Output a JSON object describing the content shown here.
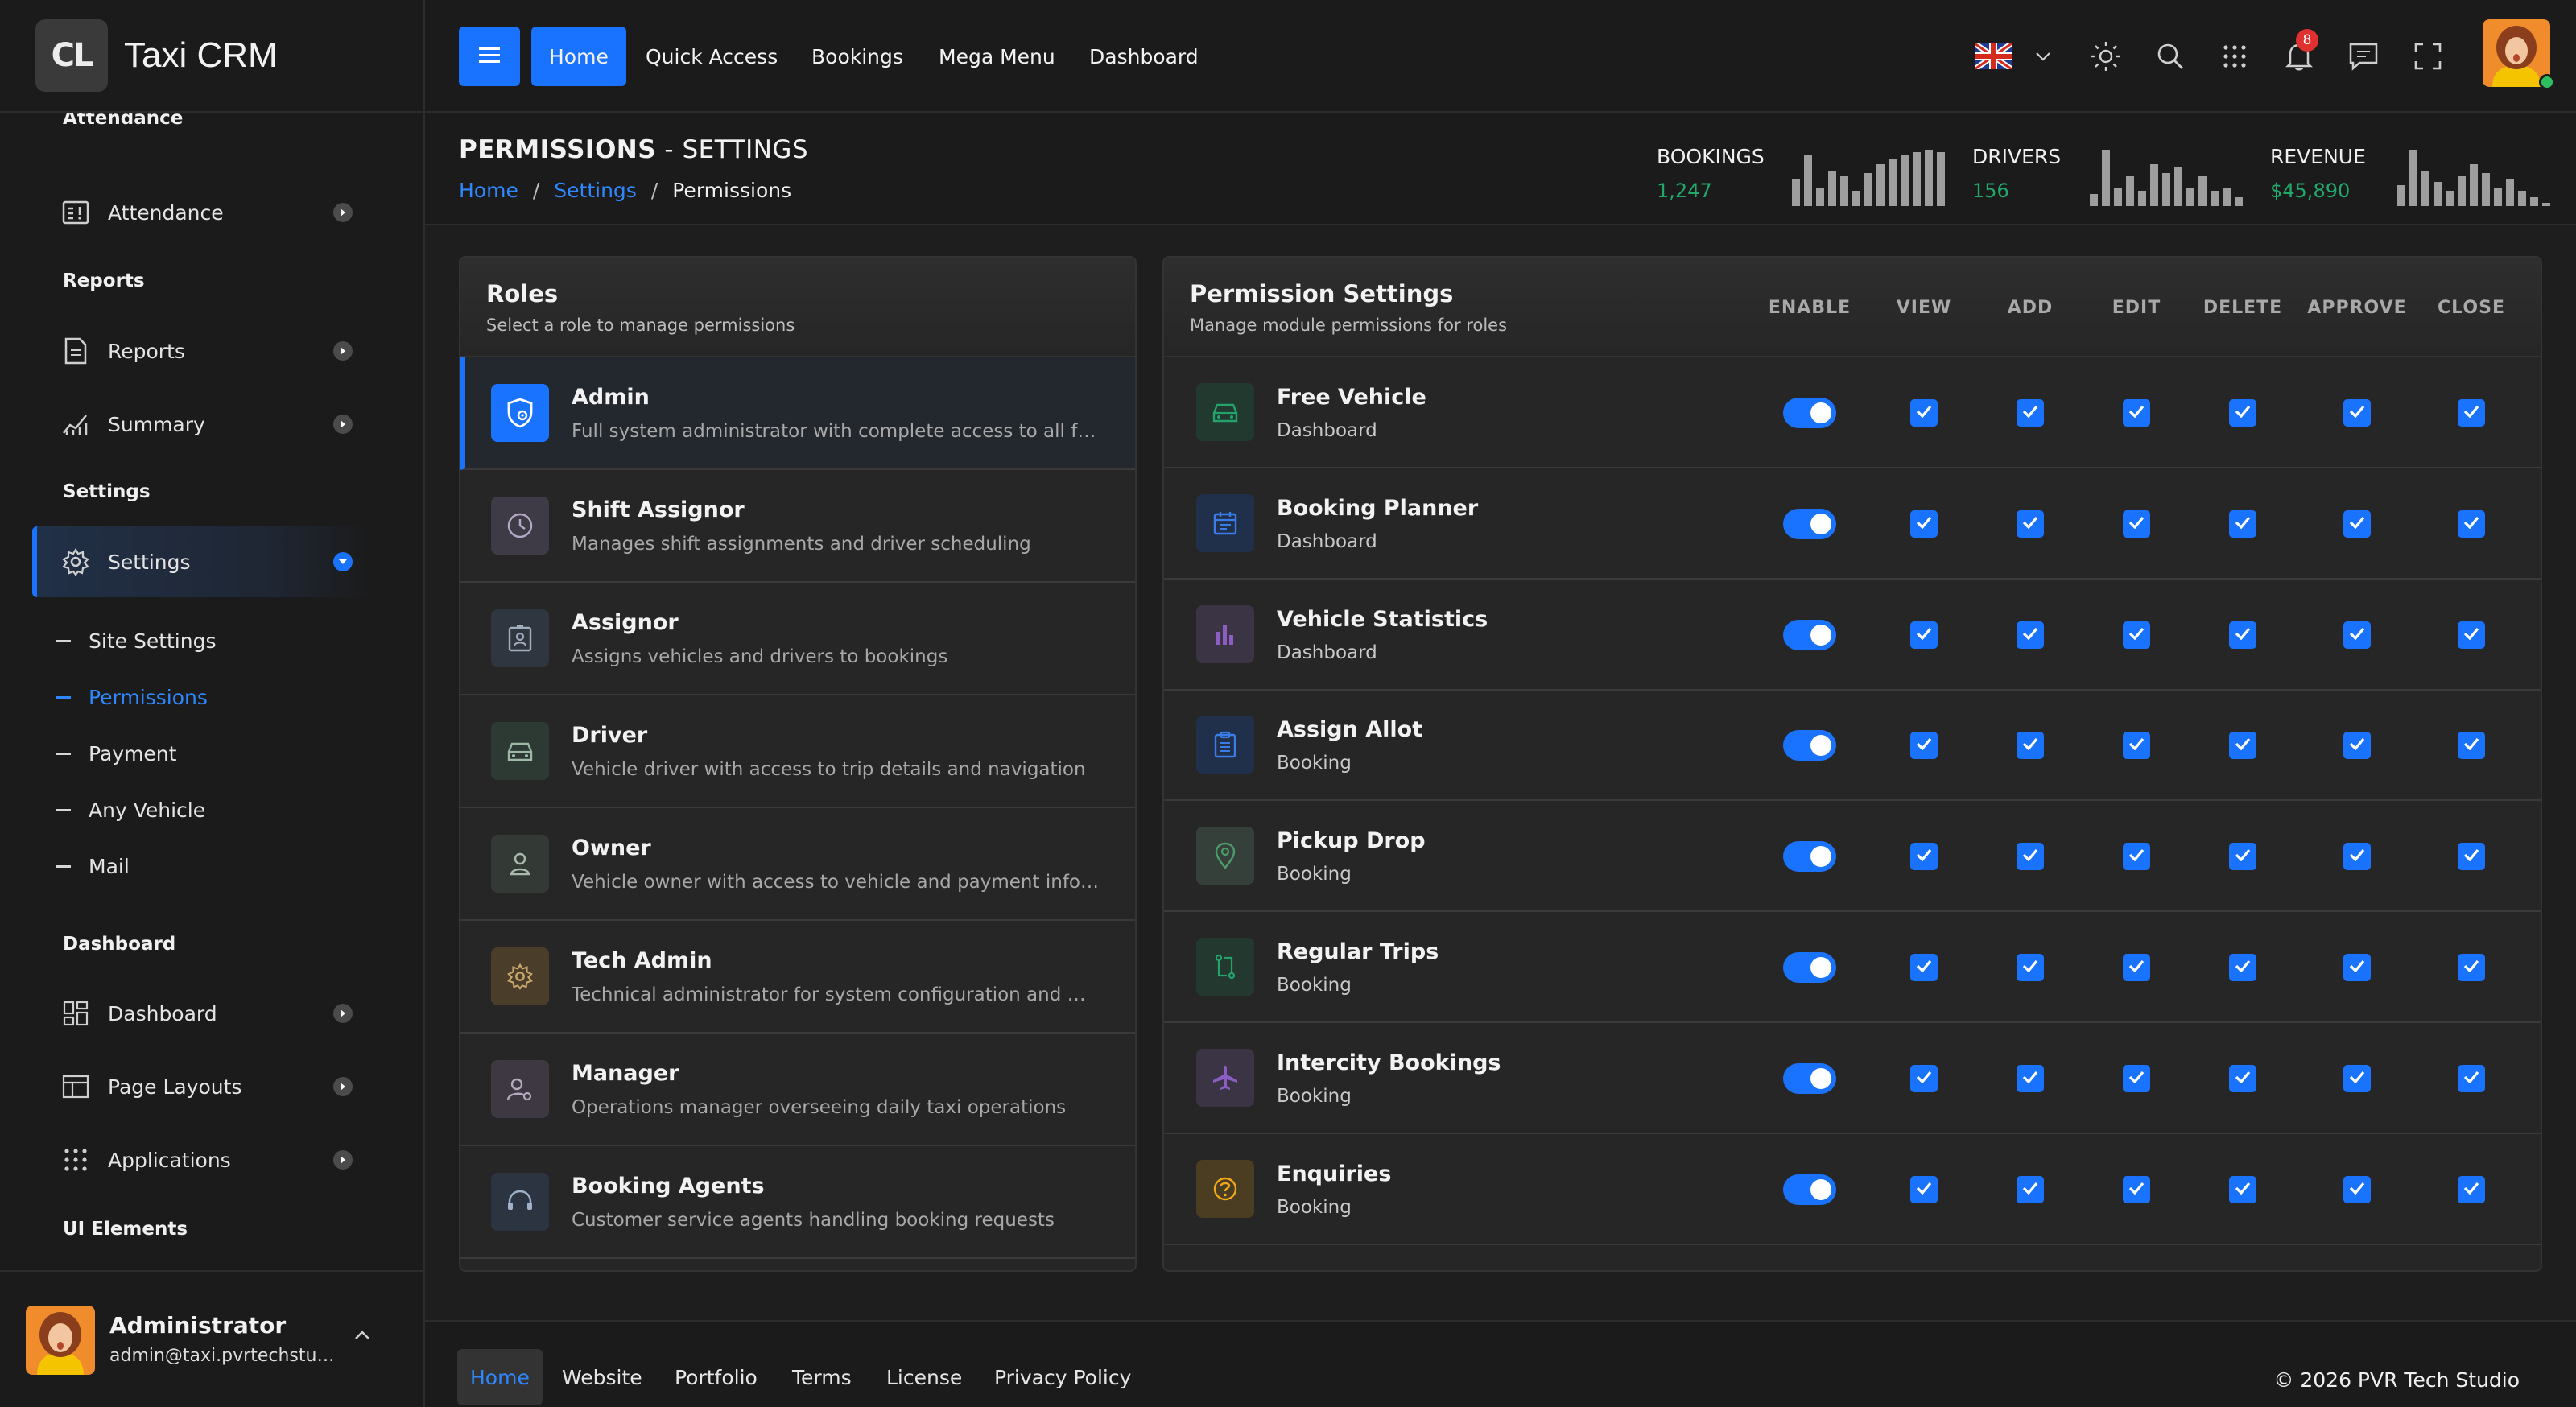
{
  "app": {
    "logo_text": "CL",
    "name": "Taxi CRM"
  },
  "sidebar": {
    "headings": {
      "attendance": "Attendance",
      "reports": "Reports",
      "settings": "Settings",
      "dashboard": "Dashboard",
      "ui_elements": "UI Elements"
    },
    "items": {
      "attendance": "Attendance",
      "reports": "Reports",
      "summary": "Summary",
      "settings": "Settings",
      "dashboard": "Dashboard",
      "page_layouts": "Page Layouts",
      "applications": "Applications"
    },
    "settings_sub": [
      "Site Settings",
      "Permissions",
      "Payment",
      "Any Vehicle",
      "Mail"
    ],
    "active_sub": "Permissions",
    "user": {
      "name": "Administrator",
      "email": "admin@taxi.pvrtechstudio.com"
    }
  },
  "header": {
    "nav": [
      "Home",
      "Quick Access",
      "Bookings",
      "Mega Menu",
      "Dashboard"
    ],
    "active_nav": "Home",
    "notification_count": "8",
    "icons": [
      "flag-uk-icon",
      "chevron-down-icon",
      "sun-icon",
      "search-icon",
      "apps-grid-icon",
      "bell-icon",
      "chat-icon",
      "fullscreen-icon"
    ]
  },
  "page": {
    "title_strong": "PERMISSIONS",
    "title_rest": " - SETTINGS",
    "breadcrumb": [
      "Home",
      "Settings",
      "Permissions"
    ],
    "stats": [
      {
        "label": "BOOKINGS",
        "value": "1,247",
        "bars": [
          0.45,
          0.85,
          0.3,
          0.6,
          0.5,
          0.25,
          0.55,
          0.7,
          0.8,
          0.85,
          0.9,
          0.95,
          0.9
        ]
      },
      {
        "label": "DRIVERS",
        "value": "156",
        "bars": [
          0.2,
          0.95,
          0.3,
          0.5,
          0.25,
          0.7,
          0.55,
          0.65,
          0.3,
          0.5,
          0.25,
          0.3,
          0.15
        ]
      },
      {
        "label": "REVENUE",
        "value": "$45,890",
        "bars": [
          0.35,
          0.95,
          0.6,
          0.4,
          0.25,
          0.5,
          0.7,
          0.55,
          0.3,
          0.45,
          0.25,
          0.15,
          0.05
        ]
      }
    ]
  },
  "roles": {
    "title": "Roles",
    "subtitle": "Select a role to manage permissions",
    "items": [
      {
        "name": "Admin",
        "desc": "Full system administrator with complete access to all features",
        "icon": "shield-user-icon"
      },
      {
        "name": "Shift Assignor",
        "desc": "Manages shift assignments and driver scheduling",
        "icon": "clock-icon"
      },
      {
        "name": "Assignor",
        "desc": "Assigns vehicles and drivers to bookings",
        "icon": "id-badge-icon"
      },
      {
        "name": "Driver",
        "desc": "Vehicle driver with access to trip details and navigation",
        "icon": "car-icon"
      },
      {
        "name": "Owner",
        "desc": "Vehicle owner with access to vehicle and payment information",
        "icon": "user-icon"
      },
      {
        "name": "Tech Admin",
        "desc": "Technical administrator for system configuration and maintenance",
        "icon": "gear-icon"
      },
      {
        "name": "Manager",
        "desc": "Operations manager overseeing daily taxi operations",
        "icon": "user-settings-icon"
      },
      {
        "name": "Booking Agents",
        "desc": "Customer service agents handling booking requests",
        "icon": "headset-icon"
      }
    ]
  },
  "permissions": {
    "title": "Permission Settings",
    "subtitle": "Manage module permissions for roles",
    "columns": [
      "ENABLE",
      "VIEW",
      "ADD",
      "EDIT",
      "DELETE",
      "APPROVE",
      "CLOSE"
    ],
    "rows": [
      {
        "name": "Free Vehicle",
        "module": "Dashboard",
        "icon": "car-icon",
        "enabled": true
      },
      {
        "name": "Booking Planner",
        "module": "Dashboard",
        "icon": "calendar-icon",
        "enabled": true
      },
      {
        "name": "Vehicle Statistics",
        "module": "Dashboard",
        "icon": "bar-chart-icon",
        "enabled": true
      },
      {
        "name": "Assign Allot",
        "module": "Booking",
        "icon": "clipboard-list-icon",
        "enabled": true
      },
      {
        "name": "Pickup Drop",
        "module": "Booking",
        "icon": "map-pin-icon",
        "enabled": true
      },
      {
        "name": "Regular Trips",
        "module": "Booking",
        "icon": "route-icon",
        "enabled": true
      },
      {
        "name": "Intercity Bookings",
        "module": "Booking",
        "icon": "plane-icon",
        "enabled": true
      },
      {
        "name": "Enquiries",
        "module": "Booking",
        "icon": "help-circle-icon",
        "enabled": true
      }
    ]
  },
  "footer": {
    "links": [
      "Home",
      "Website",
      "Portfolio",
      "Terms",
      "License",
      "Privacy Policy"
    ],
    "active": "Home",
    "copyright": "© 2026  PVR Tech Studio"
  },
  "colors": {
    "accent": "#1a73ff",
    "success": "#22a86a",
    "badge": "#e03131"
  }
}
